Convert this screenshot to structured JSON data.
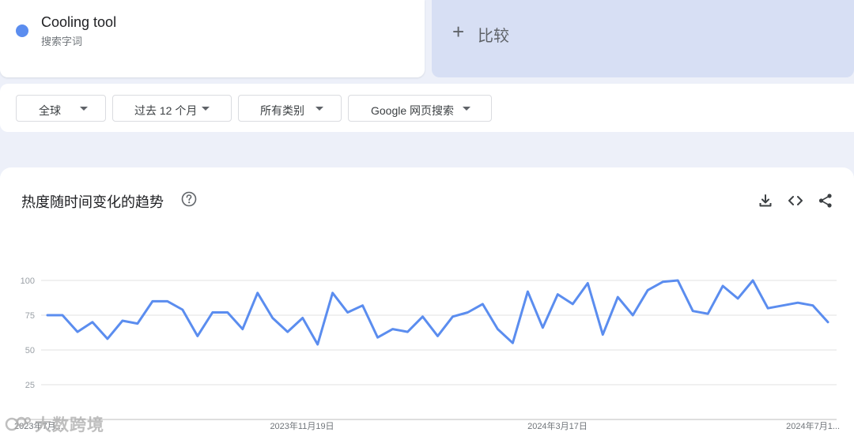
{
  "search_term": {
    "name": "Cooling tool",
    "type": "搜索字词",
    "color": "#5b8def"
  },
  "compare": {
    "icon": "plus-icon",
    "label": "比较"
  },
  "filters": [
    {
      "label": "全球"
    },
    {
      "label": "过去 12 个月"
    },
    {
      "label": "所有类别"
    },
    {
      "label": "Google 网页搜索"
    }
  ],
  "chart": {
    "title": "热度随时间变化的趋势",
    "icons": [
      "help-icon",
      "download-icon",
      "embed-icon",
      "share-icon"
    ]
  },
  "watermark": "大数跨境",
  "chart_data": {
    "type": "line",
    "title": "热度随时间变化的趋势",
    "xlabel": "",
    "ylabel": "",
    "ylim": [
      0,
      100
    ],
    "y_ticks": [
      25,
      50,
      75,
      100
    ],
    "x_tick_labels": [
      "2023年7月...",
      "2023年11月19日",
      "2024年3月17日",
      "2024年7月1..."
    ],
    "grid": true,
    "series": [
      {
        "name": "Cooling tool",
        "color": "#5b8def",
        "values": [
          75,
          75,
          63,
          70,
          58,
          71,
          69,
          85,
          85,
          79,
          60,
          77,
          77,
          65,
          91,
          73,
          63,
          73,
          54,
          91,
          77,
          82,
          59,
          65,
          63,
          74,
          60,
          74,
          77,
          83,
          65,
          55,
          92,
          66,
          90,
          83,
          98,
          61,
          88,
          75,
          93,
          99,
          100,
          78,
          76,
          96,
          87,
          100,
          80,
          82,
          84,
          82,
          70
        ]
      }
    ]
  }
}
